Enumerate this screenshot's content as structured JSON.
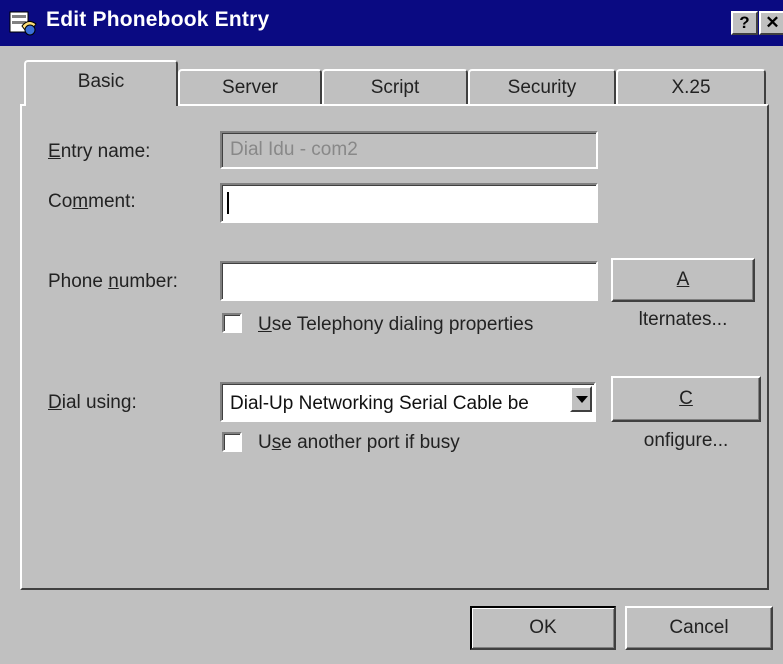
{
  "window": {
    "title": "Edit Phonebook Entry",
    "help_glyph": "?",
    "close_glyph": "✕",
    "icon": "phonebook-icon"
  },
  "tabs": [
    {
      "label": "Basic",
      "active": true
    },
    {
      "label": "Server",
      "active": false
    },
    {
      "label": "Script",
      "active": false
    },
    {
      "label": "Security",
      "active": false
    },
    {
      "label": "X.25",
      "active": false
    }
  ],
  "form": {
    "entry_name": {
      "label_pre": "",
      "label_u": "E",
      "label_post": "ntry name:",
      "value": "Dial Idu - com2",
      "disabled": true
    },
    "comment": {
      "label_pre": "Co",
      "label_u": "m",
      "label_post": "ment:",
      "value": ""
    },
    "phone_number": {
      "label_pre": "Phone ",
      "label_u": "n",
      "label_post": "umber:",
      "value": ""
    },
    "alternates_button": {
      "label_pre": "",
      "label_u": "A",
      "label_post": "lternates..."
    },
    "use_telephony": {
      "label_pre": "",
      "label_u": "U",
      "label_post": "se Telephony dialing properties",
      "checked": false
    },
    "dial_using": {
      "label_pre": "",
      "label_u": "D",
      "label_post": "ial using:",
      "value": "Dial-Up Networking Serial Cable be"
    },
    "configure_button": {
      "label_pre": "",
      "label_u": "C",
      "label_post": "onfigure..."
    },
    "use_another_port": {
      "label_pre": "U",
      "label_u": "s",
      "label_post": "e another port if busy",
      "checked": false
    }
  },
  "buttons": {
    "ok": "OK",
    "cancel": "Cancel"
  }
}
